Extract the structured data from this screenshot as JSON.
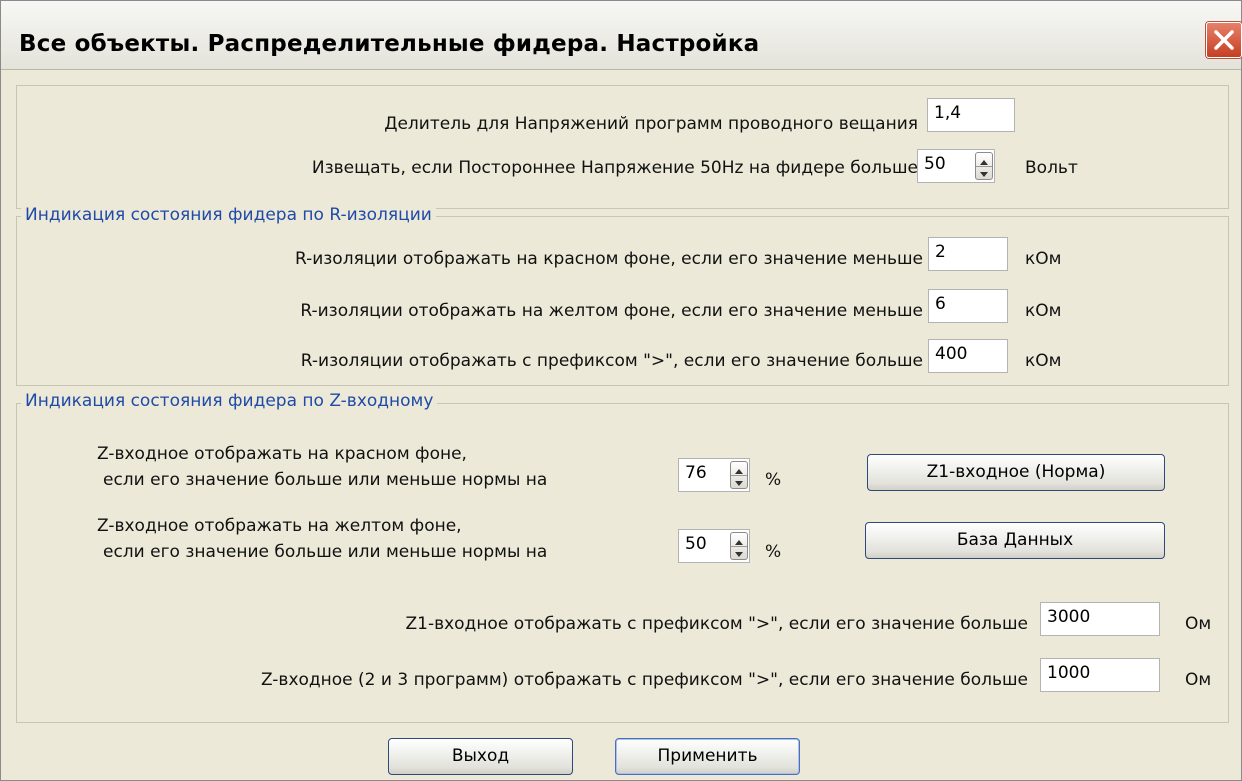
{
  "window": {
    "title": "Все объекты.  Распределительные фидера.  Настройка"
  },
  "general": {
    "divider_label": "Делитель для Напряжений программ проводного вещания",
    "divider_value": "1,4",
    "notify_label": "Извещать, если Постороннее Напряжение 50Hz на фидере больше",
    "notify_value": "50",
    "notify_unit": "Вольт"
  },
  "r_isolation": {
    "legend": "Индикация состояния фидера по R-изоляции",
    "rows": [
      {
        "label": "R-изоляции отображать на красном фоне, если его значение меньше",
        "value": "2",
        "unit": "кОм"
      },
      {
        "label": "R-изоляции отображать на желтом фоне, если его значение меньше",
        "value": "6",
        "unit": "кОм"
      },
      {
        "label": "R-изоляции отображать с префиксом  \">\", если его значение больше",
        "value": "400",
        "unit": "кОм"
      }
    ]
  },
  "z_input": {
    "legend": "Индикация состояния фидера по Z-входному",
    "red_label_1": "Z-входное отображать на красном фоне,",
    "red_label_2": "если его значение больше или меньше нормы на",
    "red_value": "76",
    "red_unit": "%",
    "yellow_label_1": "Z-входное отображать на желтом фоне,",
    "yellow_label_2": "если его значение больше или меньше нормы на",
    "yellow_value": "50",
    "yellow_unit": "%",
    "z1_norm_button": "Z1-входное (Норма)",
    "database_button": "База Данных",
    "z1_prefix_label": "Z1-входное отображать с префиксом  \">\", если его значение больше",
    "z1_prefix_value": "3000",
    "z1_prefix_unit": "Ом",
    "z23_prefix_label": "Z-входное (2 и 3 программ)  отображать с префиксом  \">\", если его значение больше",
    "z23_prefix_value": "1000",
    "z23_prefix_unit": "Ом"
  },
  "footer": {
    "exit_button": "Выход",
    "apply_button": "Применить"
  }
}
